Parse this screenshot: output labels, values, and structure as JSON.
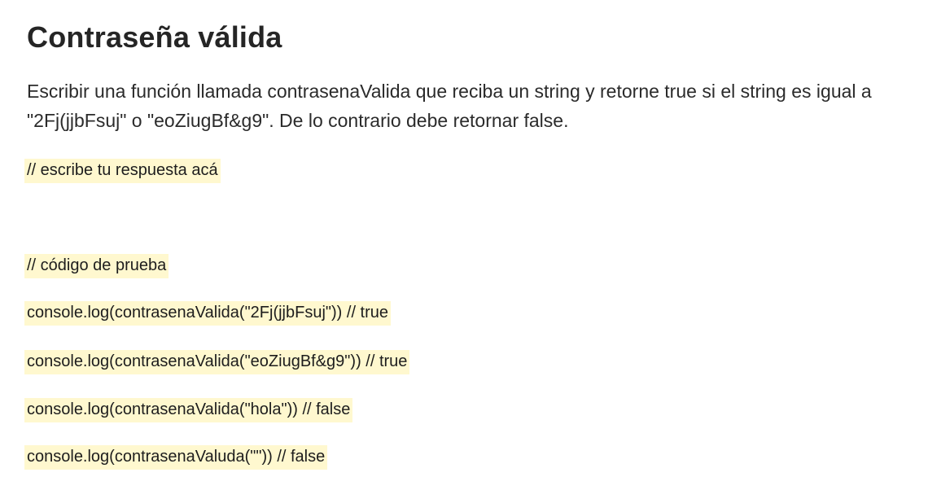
{
  "title": "Contraseña válida",
  "description": "Escribir una función llamada contrasenaValida que reciba un string y retorne true si el string es igual a \"2Fj(jjbFsuj\" o \"eoZiugBf&g9\". De lo contrario debe retornar false.",
  "code_lines": [
    "// escribe tu respuesta acá",
    "// código de prueba",
    "console.log(contrasenaValida(\"2Fj(jjbFsuj\")) // true",
    "console.log(contrasenaValida(\"eoZiugBf&g9\")) // true",
    "console.log(contrasenaValida(\"hola\")) // false",
    "console.log(contrasenaValuda(\"\")) // false"
  ],
  "colors": {
    "code_highlight": "#fff8cf",
    "text": "#252525"
  }
}
